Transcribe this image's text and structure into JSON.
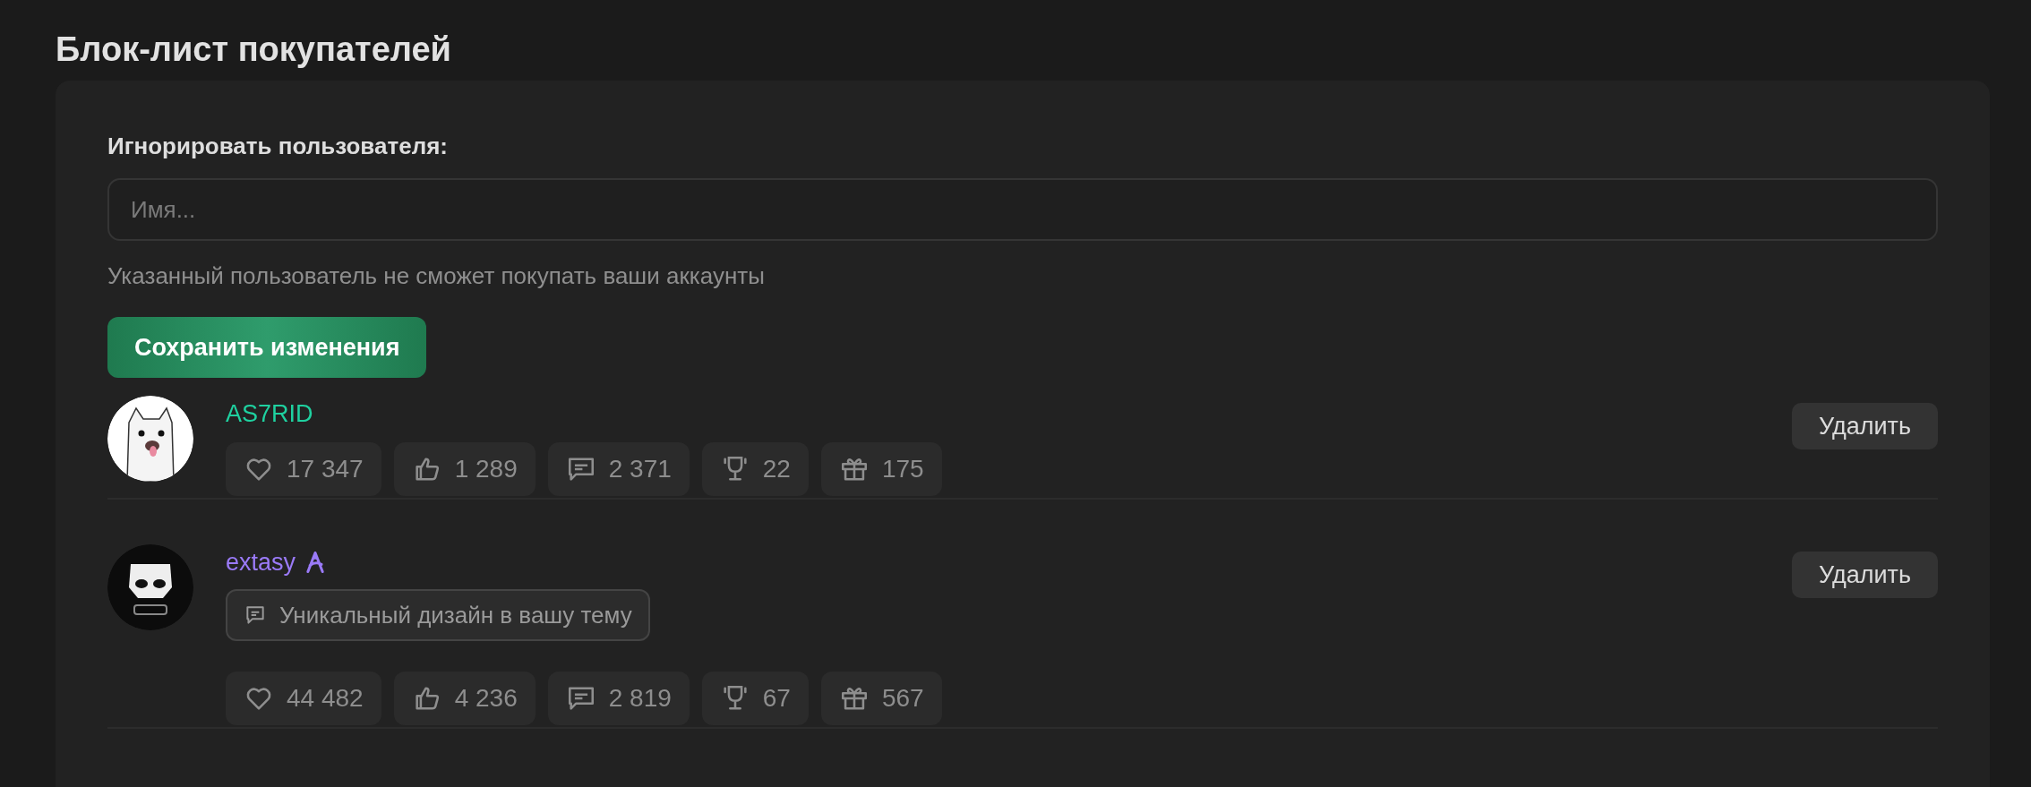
{
  "title": "Блок-лист покупателей",
  "form": {
    "label": "Игнорировать пользователя:",
    "placeholder": "Имя...",
    "hint": "Указанный пользователь не сможет покупать ваши аккаунты",
    "save_button": "Сохранить изменения"
  },
  "users": [
    {
      "name": "AS7RID",
      "color": "#1fd1a0",
      "designer": false,
      "delete_button": "Удалить",
      "stats": [
        {
          "kind": "likes",
          "value": "17 347"
        },
        {
          "kind": "thumbs",
          "value": "1 289"
        },
        {
          "kind": "messages",
          "value": "2 371"
        },
        {
          "kind": "trophies",
          "value": "22"
        },
        {
          "kind": "gifts",
          "value": "175"
        }
      ]
    },
    {
      "name": "extasy",
      "color": "#9a7af7",
      "designer": true,
      "status": "Уникальный дизайн в вашу тему",
      "delete_button": "Удалить",
      "stats": [
        {
          "kind": "likes",
          "value": "44 482"
        },
        {
          "kind": "thumbs",
          "value": "4 236"
        },
        {
          "kind": "messages",
          "value": "2 819"
        },
        {
          "kind": "trophies",
          "value": "67"
        },
        {
          "kind": "gifts",
          "value": "567"
        }
      ]
    }
  ]
}
